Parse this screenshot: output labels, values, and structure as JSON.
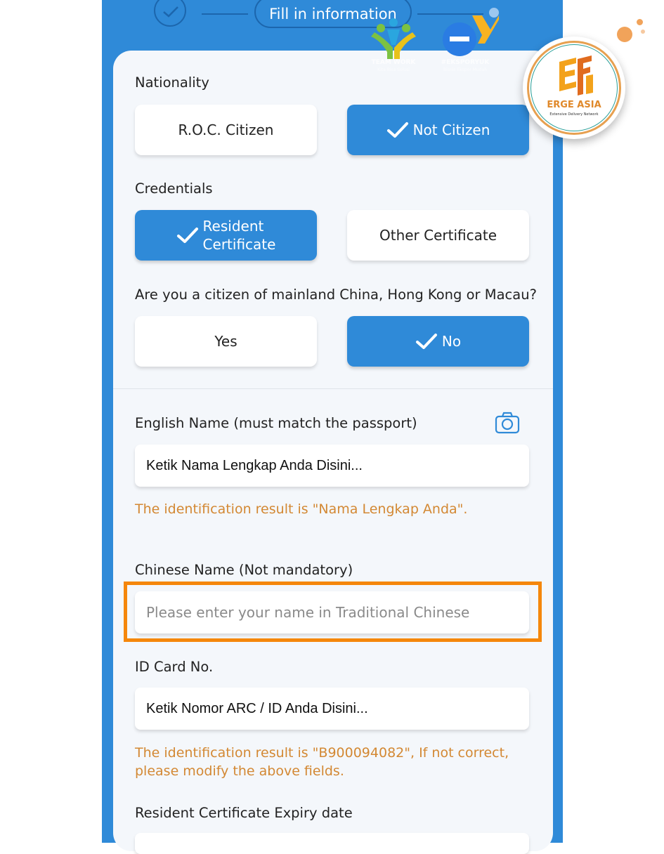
{
  "stepper": {
    "current_step_label": "Fill in information"
  },
  "watermarks": {
    "teamwork_text": "TEAM WORK",
    "teamwork_sub": "Kita Bisa Solusi",
    "ey_text": "#EKSPORYUK",
    "ey_sub": "Bisnis Ekspor Mudah"
  },
  "logo": {
    "name": "ERGE ASIA",
    "tagline": "Extensive Delivery Network"
  },
  "form": {
    "nationality": {
      "label": "Nationality",
      "options": [
        {
          "label": "R.O.C. Citizen",
          "selected": false
        },
        {
          "label": "Not Citizen",
          "selected": true
        }
      ]
    },
    "credentials": {
      "label": "Credentials",
      "options": [
        {
          "label_line1": "Resident",
          "label_line2": "Certificate",
          "selected": true
        },
        {
          "label": "Other Certificate",
          "selected": false
        }
      ]
    },
    "mainland": {
      "label": "Are you a citizen of mainland China, Hong Kong or Macau?",
      "options": [
        {
          "label": "Yes",
          "selected": false
        },
        {
          "label": "No",
          "selected": true
        }
      ]
    },
    "english_name": {
      "label": "English Name (must match the passport)",
      "value": "Ketik Nama Lengkap Anda Disini...",
      "hint": "The identification result is \"Nama Lengkap Anda\"."
    },
    "chinese_name": {
      "label": "Chinese Name (Not mandatory)",
      "placeholder": "Please enter your name in Traditional Chinese"
    },
    "id_card": {
      "label": "ID Card No.",
      "value": "Ketik Nomor ARC / ID Anda Disini...",
      "hint_line1": "The identification result is \"B900094082\", If not correct,",
      "hint_line2": "please modify the above fields."
    },
    "expiry": {
      "label": "Resident Certificate Expiry date"
    }
  },
  "colors": {
    "primary": "#2f8ad8",
    "hint": "#d38833",
    "highlight": "#f5870b",
    "card": "#f4f7fb"
  }
}
